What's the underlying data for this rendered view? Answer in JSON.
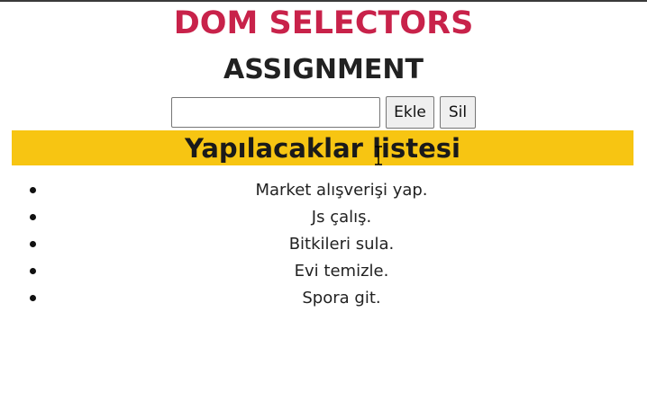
{
  "header": {
    "title": "DOM SELECTORS",
    "subtitle": "ASSIGNMENT"
  },
  "controls": {
    "input_value": "",
    "input_placeholder": "",
    "add_label": "Ekle",
    "delete_label": "Sil"
  },
  "list": {
    "title": "Yapılacaklar listesi",
    "items": [
      {
        "label": "Market alışverişi yap."
      },
      {
        "label": "Js çalış."
      },
      {
        "label": "Bitkileri sula."
      },
      {
        "label": "Evi temizle."
      },
      {
        "label": "Spora git."
      }
    ]
  },
  "colors": {
    "title": "#c8224a",
    "list_header_bg": "#f7c512"
  },
  "icons": {
    "cursor": "text-cursor-icon",
    "bullet": "bullet-dot-icon"
  }
}
